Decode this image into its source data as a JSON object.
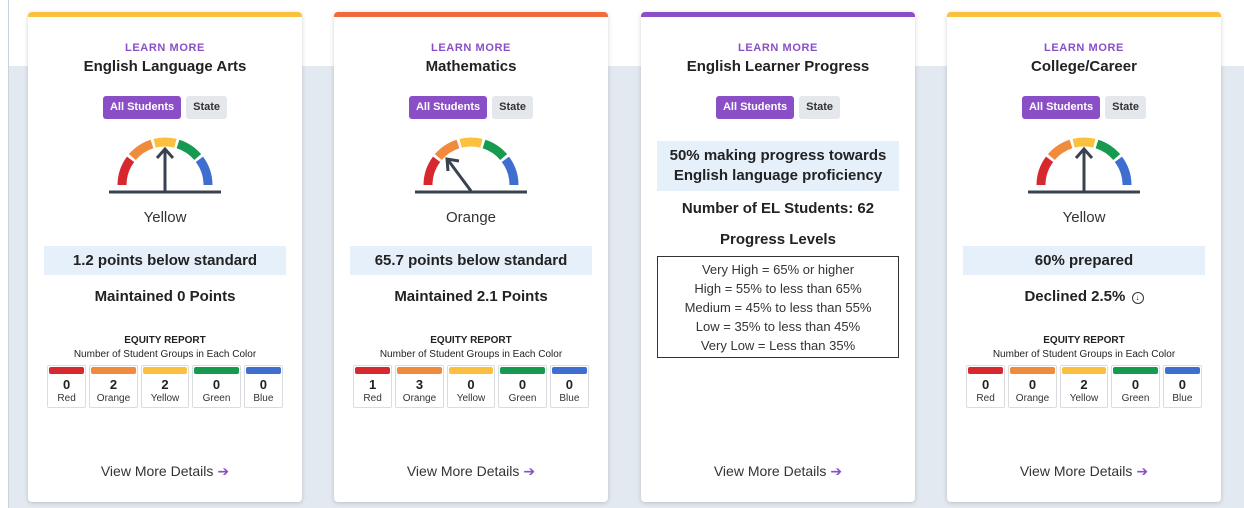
{
  "colors": {
    "red": "#d7282f",
    "orange": "#f08a3c",
    "yellow": "#fbc03d",
    "green": "#169a50",
    "blue": "#3f6ed1",
    "purple": "#8a4fc6",
    "ela_bar": "#fbc03d",
    "math_bar": "#f06a3a",
    "el_bar": "#8a4fc6",
    "cc_bar": "#fbc03d"
  },
  "cards": [
    {
      "learn_more": "LEARN MORE",
      "title": "English Language Arts",
      "toggle_all": "All Students",
      "toggle_state": "State",
      "gauge_color": "Yellow",
      "status": "1.2 points below standard",
      "change": "Maintained 0 Points",
      "equity_title": "EQUITY REPORT",
      "equity_sub": "Number of Student Groups in Each Color",
      "equity": [
        {
          "count": "0",
          "label": "Red"
        },
        {
          "count": "2",
          "label": "Orange"
        },
        {
          "count": "2",
          "label": "Yellow"
        },
        {
          "count": "0",
          "label": "Green"
        },
        {
          "count": "0",
          "label": "Blue"
        }
      ],
      "details": "View More Details"
    },
    {
      "learn_more": "LEARN MORE",
      "title": "Mathematics",
      "toggle_all": "All Students",
      "toggle_state": "State",
      "gauge_color": "Orange",
      "status": "65.7 points below standard",
      "change": "Maintained 2.1 Points",
      "equity_title": "EQUITY REPORT",
      "equity_sub": "Number of Student Groups in Each Color",
      "equity": [
        {
          "count": "1",
          "label": "Red"
        },
        {
          "count": "3",
          "label": "Orange"
        },
        {
          "count": "0",
          "label": "Yellow"
        },
        {
          "count": "0",
          "label": "Green"
        },
        {
          "count": "0",
          "label": "Blue"
        }
      ],
      "details": "View More Details"
    },
    {
      "learn_more": "LEARN MORE",
      "title": "English Learner Progress",
      "toggle_all": "All Students",
      "toggle_state": "State",
      "progress": "50% making progress towards English language proficiency",
      "el_count": "Number of EL Students: 62",
      "levels_title": "Progress Levels",
      "levels": [
        "Very High = 65% or higher",
        "High = 55% to less than 65%",
        "Medium = 45% to less than 55%",
        "Low = 35% to less than 45%",
        "Very Low = Less than 35%"
      ],
      "details": "View More Details"
    },
    {
      "learn_more": "LEARN MORE",
      "title": "College/Career",
      "toggle_all": "All Students",
      "toggle_state": "State",
      "gauge_color": "Yellow",
      "status": "60% prepared",
      "change": "Declined 2.5%",
      "equity_title": "EQUITY REPORT",
      "equity_sub": "Number of Student Groups in Each Color",
      "equity": [
        {
          "count": "0",
          "label": "Red"
        },
        {
          "count": "0",
          "label": "Orange"
        },
        {
          "count": "2",
          "label": "Yellow"
        },
        {
          "count": "0",
          "label": "Green"
        },
        {
          "count": "0",
          "label": "Blue"
        }
      ],
      "details": "View More Details"
    }
  ]
}
